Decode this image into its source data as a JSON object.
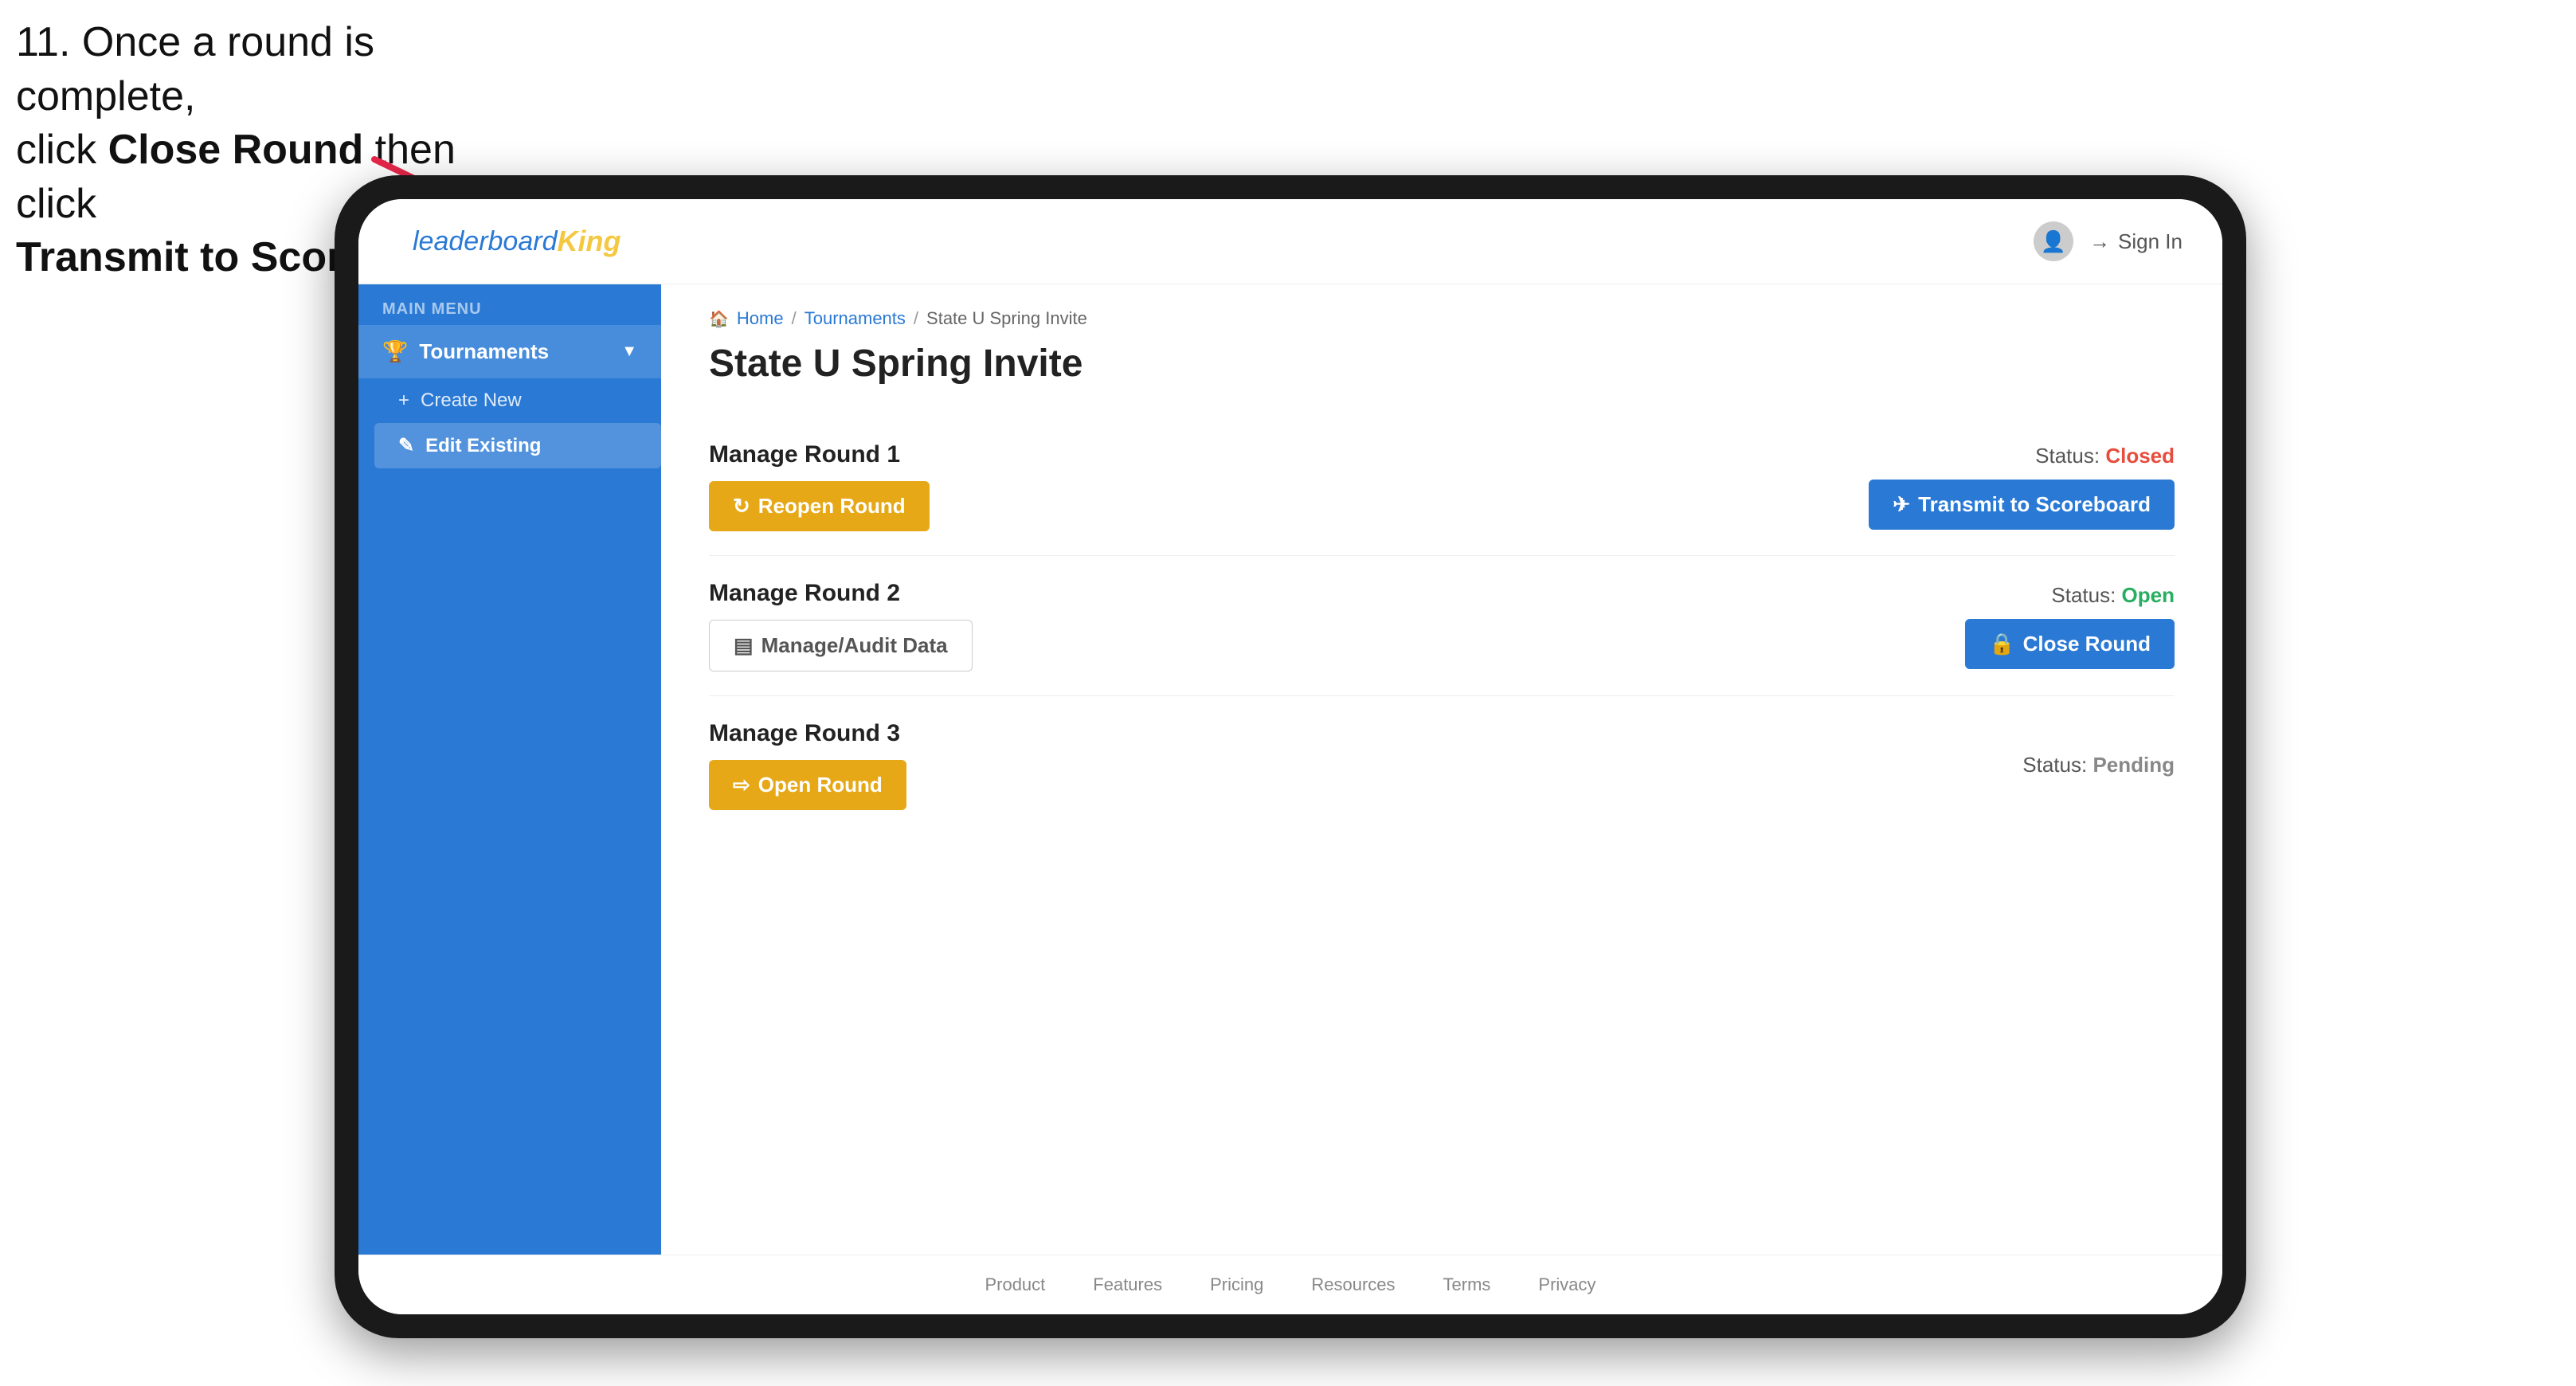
{
  "instruction": {
    "line1": "11. Once a round is complete,",
    "line2": "click ",
    "bold1": "Close Round",
    "line3": " then click",
    "bold2": "Transmit to Scoreboard."
  },
  "sidebar": {
    "logo": {
      "leaderboard": "leaderboard",
      "king": "King"
    },
    "main_menu_label": "MAIN MENU",
    "items": [
      {
        "id": "tournaments",
        "label": "Tournaments",
        "icon": "trophy",
        "has_chevron": true
      }
    ],
    "sub_items": [
      {
        "id": "create-new",
        "label": "Create New",
        "icon": "plus"
      },
      {
        "id": "edit-existing",
        "label": "Edit Existing",
        "icon": "edit",
        "active": true
      }
    ]
  },
  "topnav": {
    "sign_in_label": "Sign In"
  },
  "breadcrumb": {
    "home": "Home",
    "tournaments": "Tournaments",
    "current": "State U Spring Invite"
  },
  "page": {
    "title": "State U Spring Invite"
  },
  "rounds": [
    {
      "id": "round1",
      "title": "Manage Round 1",
      "status_label": "Status:",
      "status_value": "Closed",
      "status_type": "closed",
      "buttons": [
        {
          "id": "reopen-round",
          "label": "Reopen Round",
          "style": "gold",
          "icon": "reopen"
        },
        {
          "id": "transmit-scoreboard",
          "label": "Transmit to Scoreboard",
          "style": "blue",
          "icon": "transmit"
        }
      ]
    },
    {
      "id": "round2",
      "title": "Manage Round 2",
      "status_label": "Status:",
      "status_value": "Open",
      "status_type": "open",
      "buttons": [
        {
          "id": "manage-audit",
          "label": "Manage/Audit Data",
          "style": "outline",
          "icon": "audit"
        },
        {
          "id": "close-round",
          "label": "Close Round",
          "style": "blue",
          "icon": "close"
        }
      ]
    },
    {
      "id": "round3",
      "title": "Manage Round 3",
      "status_label": "Status:",
      "status_value": "Pending",
      "status_type": "pending",
      "buttons": [
        {
          "id": "open-round",
          "label": "Open Round",
          "style": "gold",
          "icon": "open"
        }
      ]
    }
  ],
  "footer": {
    "links": [
      "Product",
      "Features",
      "Pricing",
      "Resources",
      "Terms",
      "Privacy"
    ]
  }
}
